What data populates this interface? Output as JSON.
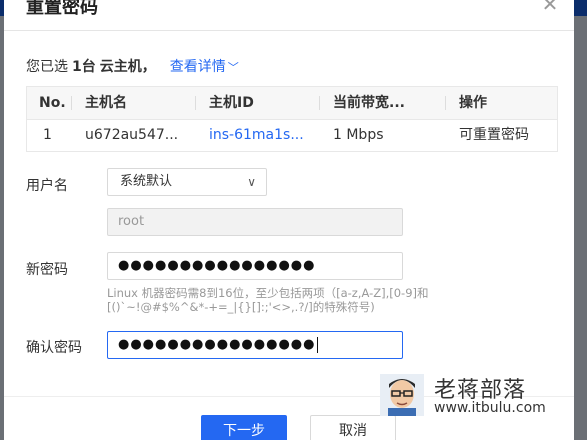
{
  "dialog": {
    "title": "重置密码",
    "close_icon": "close-icon"
  },
  "selection": {
    "prefix": "您已选",
    "count": "1台",
    "type": "云主机",
    "comma": "，",
    "details_link": "查看详情",
    "details_icon": "chevron-down-icon"
  },
  "table": {
    "headers": [
      "No.",
      "主机名",
      "主机ID",
      "当前带宽...",
      "操作"
    ],
    "rows": [
      {
        "no": "1",
        "hostname": "u672au547...",
        "host_id": "ins-61ma1s...",
        "bandwidth": "1 Mbps",
        "action": "可重置密码"
      }
    ]
  },
  "form": {
    "username_label": "用户名",
    "username_select": "系统默认",
    "username_value": "root",
    "new_password_label": "新密码",
    "new_password_value": "●●●●●●●●●●●●●●●●",
    "password_hint": "Linux 机器密码需8到16位，至少包括两项（[a-z,A-Z],[0-9]和[()`~!@#$%^&*-+=_|{}[]:;'<>,.?/]的特殊符号)",
    "confirm_password_label": "确认密码",
    "confirm_password_value": "●●●●●●●●●●●●●●●●"
  },
  "footer": {
    "next_label": "下一步",
    "cancel_label": "取消"
  },
  "watermark": {
    "name": "老蒋部落",
    "url": "www.itbulu.com"
  },
  "colors": {
    "accent": "#2468f2",
    "header_bg": "#0b2d6b"
  }
}
